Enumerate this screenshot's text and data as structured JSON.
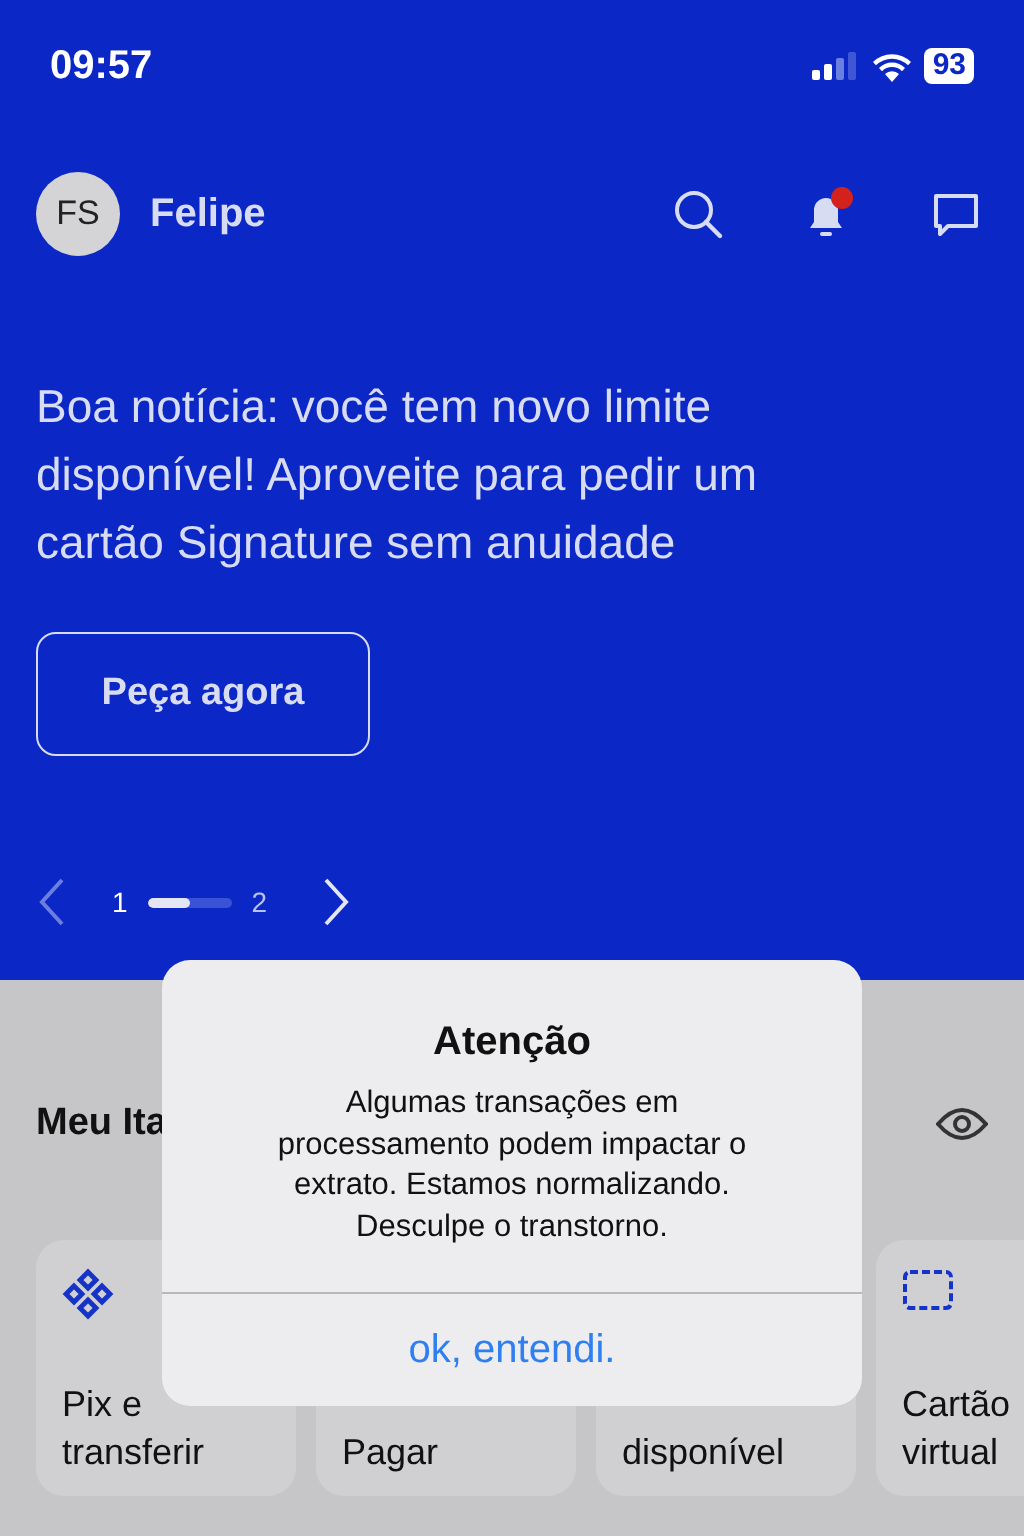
{
  "status_bar": {
    "time": "09:57",
    "battery": "93"
  },
  "header": {
    "avatar": "FS",
    "name": "Felipe",
    "notification_badge": true
  },
  "banner": {
    "text": "Boa notícia: você tem novo limite disponível! Aproveite para pedir um cartão Signature sem anuidade",
    "button": "Peça agora",
    "pager": {
      "pages": [
        {
          "label": "1",
          "selected": true
        },
        {
          "label": "2",
          "selected": false
        }
      ],
      "level": 0.5
    }
  },
  "section": {
    "title": "Meu Ita"
  },
  "shortcuts": [
    {
      "kind": "pix",
      "lines": [
        "Pix e",
        "transferir"
      ]
    },
    {
      "kind": "none",
      "lines": [
        "Pagar"
      ]
    },
    {
      "kind": "none",
      "lines": [
        "disponível"
      ]
    },
    {
      "kind": "card",
      "lines": [
        "Cartão",
        "virtual"
      ]
    }
  ],
  "alert": {
    "title": "Atenção",
    "message": "Algumas transações em processamento podem impactar o extrato. Estamos normalizando. Desculpe o transtorno.",
    "button": "ok, entendi."
  }
}
